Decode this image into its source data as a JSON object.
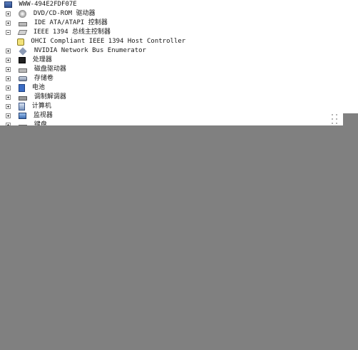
{
  "tree": {
    "root": {
      "label": "WWW-494E2FDF07E",
      "icon": "computer-icon"
    },
    "nodes": [
      {
        "label": "DVD/CD-ROM 驱动器",
        "expander": "plus",
        "icon": "cdrom-icon"
      },
      {
        "label": "IDE ATA/ATAPI 控制器",
        "expander": "plus",
        "icon": "ide-controller-icon"
      },
      {
        "label": "IEEE 1394 总线主控制器",
        "expander": "minus",
        "icon": "ieee1394-icon",
        "children": [
          {
            "label": "OHCI Compliant IEEE 1394 Host Controller",
            "icon": "device-icon"
          }
        ]
      },
      {
        "label": "NVIDIA Network Bus Enumerator",
        "expander": "plus",
        "icon": "network-bus-icon"
      },
      {
        "label": "处理器",
        "expander": "plus",
        "icon": "processor-icon"
      },
      {
        "label": "磁盘驱动器",
        "expander": "plus",
        "icon": "disk-drive-icon"
      },
      {
        "label": "存储卷",
        "expander": "plus",
        "icon": "storage-volume-icon"
      },
      {
        "label": "电池",
        "expander": "plus",
        "icon": "battery-icon"
      },
      {
        "label": "调制解调器",
        "expander": "plus",
        "icon": "modem-icon"
      },
      {
        "label": "计算机",
        "expander": "plus",
        "icon": "computer-node-icon"
      },
      {
        "label": "监视器",
        "expander": "plus",
        "icon": "monitor-icon"
      },
      {
        "label": "键盘",
        "expander": "plus",
        "icon": "keyboard-icon"
      }
    ]
  }
}
